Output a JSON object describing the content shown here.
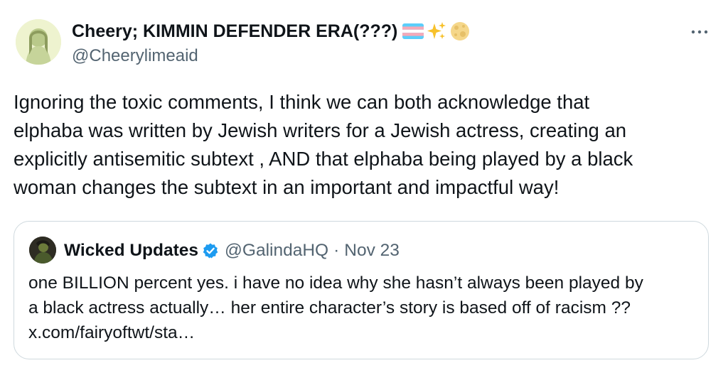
{
  "author": {
    "display_name": "Cheery; KIMMIN DEFENDER ERA(???)",
    "name_emojis": [
      "transgender-flag-icon",
      "sparkles-icon",
      "moon-icon"
    ],
    "handle": "@Cheerylimeaid",
    "avatar": "avatar"
  },
  "tweet": {
    "lines": [
      "Ignoring the toxic comments, I think we can both acknowledge that",
      "elphaba was written by Jewish writers for a Jewish actress, creating an",
      "explicitly antisemitic subtext , AND that elphaba being played by a black",
      "woman changes the subtext in an important and impactful way!"
    ]
  },
  "quoted_tweet": {
    "display_name": "Wicked Updates",
    "verified": true,
    "handle": "@GalindaHQ",
    "separator": "·",
    "date": "Nov 23",
    "lines": [
      "one BILLION percent yes. i have no idea why she hasn’t always been played by",
      "a black actress actually… her entire character’s story is based off of racism ??",
      "x.com/fairyoftwt/sta…"
    ]
  },
  "colors": {
    "text_primary": "#0f1419",
    "text_secondary": "#536471",
    "border": "#cfd9de",
    "verified_blue": "#1d9bf0"
  }
}
